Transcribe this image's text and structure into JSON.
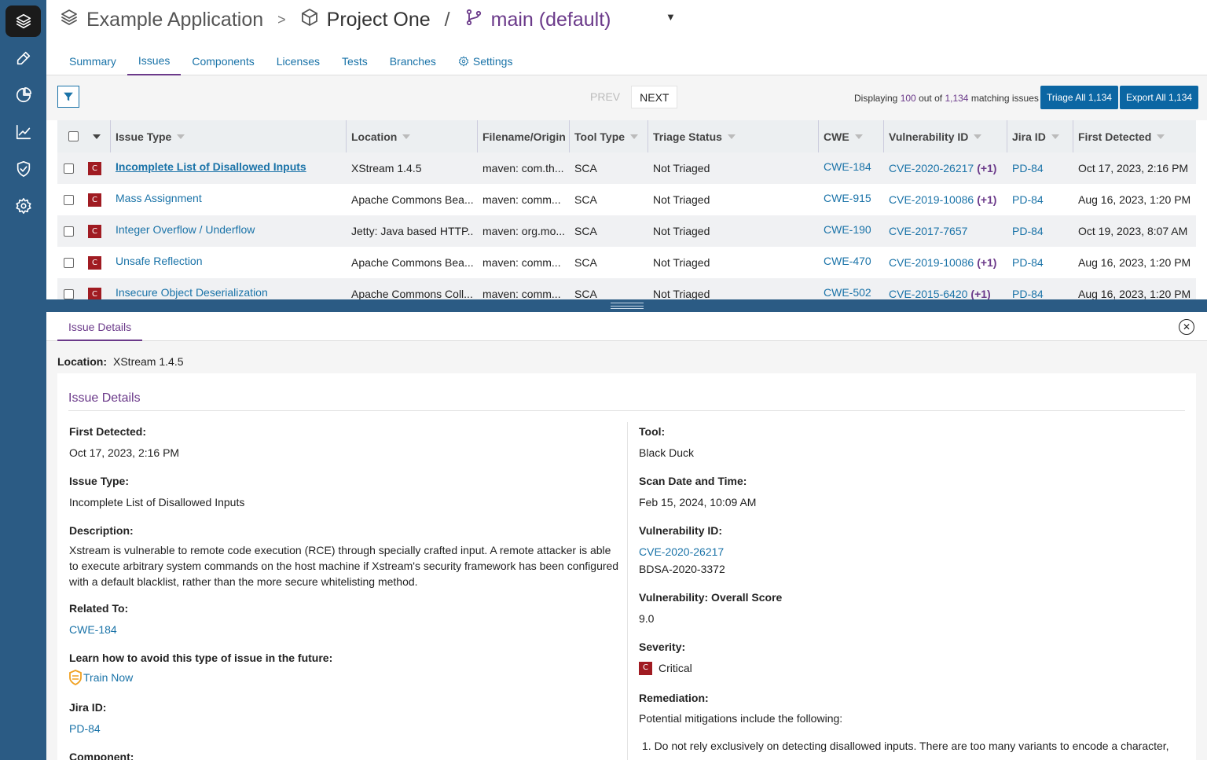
{
  "header": {
    "app_name": "Example Application",
    "separator": ">",
    "project": "Project One",
    "branch_separator": "/",
    "branch": "main (default)",
    "branch_caret": "▼"
  },
  "tabs": [
    "Summary",
    "Issues",
    "Components",
    "Licenses",
    "Tests",
    "Branches",
    "Settings"
  ],
  "toolbar": {
    "prev": "PREV",
    "next": "NEXT",
    "display_prefix": "Displaying",
    "display_count": "100",
    "display_mid": "out of",
    "display_total": "1,134",
    "display_suffix": "matching issues",
    "triage_all": "Triage All 1,134",
    "export_all": "Export All 1,134"
  },
  "table": {
    "columns": [
      "Issue Type",
      "Location",
      "Filename/Origin",
      "Tool Type",
      "Triage Status",
      "CWE",
      "Vulnerability ID",
      "Jira ID",
      "First Detected"
    ],
    "rows": [
      {
        "sev": "C",
        "type": "Incomplete List of Disallowed Inputs",
        "location": "XStream 1.4.5",
        "origin": "maven: com.th...",
        "tool": "SCA",
        "triage": "Not Triaged",
        "cwe": "CWE-184",
        "vuln": "CVE-2020-26217",
        "vuln_extra": "(+1)",
        "jira": "PD-84",
        "detected": "Oct 17, 2023, 2:16 PM"
      },
      {
        "sev": "C",
        "type": "Mass Assignment",
        "location": "Apache Commons Bea...",
        "origin": "maven: comm...",
        "tool": "SCA",
        "triage": "Not Triaged",
        "cwe": "CWE-915",
        "vuln": "CVE-2019-10086",
        "vuln_extra": "(+1)",
        "jira": "PD-84",
        "detected": "Aug 16, 2023, 1:20 PM"
      },
      {
        "sev": "C",
        "type": "Integer Overflow / Underflow",
        "location": "Jetty: Java based HTTP...",
        "origin": "maven: org.mo...",
        "tool": "SCA",
        "triage": "Not Triaged",
        "cwe": "CWE-190",
        "vuln": "CVE-2017-7657",
        "vuln_extra": "",
        "jira": "PD-84",
        "detected": "Oct 19, 2023, 8:07 AM"
      },
      {
        "sev": "C",
        "type": "Unsafe Reflection",
        "location": "Apache Commons Bea...",
        "origin": "maven: comm...",
        "tool": "SCA",
        "triage": "Not Triaged",
        "cwe": "CWE-470",
        "vuln": "CVE-2019-10086",
        "vuln_extra": "(+1)",
        "jira": "PD-84",
        "detected": "Aug 16, 2023, 1:20 PM"
      },
      {
        "sev": "C",
        "type": "Insecure Object Deserialization",
        "location": "Apache Commons Coll...",
        "origin": "maven: comm...",
        "tool": "SCA",
        "triage": "Not Triaged",
        "cwe": "CWE-502",
        "vuln": "CVE-2015-6420",
        "vuln_extra": "(+1)",
        "jira": "PD-84",
        "detected": "Aug 16, 2023, 1:20 PM"
      }
    ]
  },
  "details": {
    "tab": "Issue Details",
    "close": "✕",
    "location_label": "Location:",
    "location_value": "XStream 1.4.5",
    "card_title": "Issue Details",
    "left": {
      "first_detected_label": "First Detected:",
      "first_detected": "Oct 17, 2023, 2:16 PM",
      "issue_type_label": "Issue Type:",
      "issue_type": "Incomplete List of Disallowed Inputs",
      "description_label": "Description:",
      "description": "Xstream is vulnerable to remote code execution (RCE) through specially crafted input. A remote attacker is able to execute arbitrary system commands on the host machine if Xstream's security framework has been configured with a default blacklist, rather than the more secure whitelisting method.",
      "related_label": "Related To:",
      "related": "CWE-184",
      "learn_label": "Learn how to avoid this type of issue in the future:",
      "train_now": "Train Now",
      "jira_label": "Jira ID:",
      "jira": "PD-84",
      "component_label": "Component:"
    },
    "right": {
      "tool_label": "Tool:",
      "tool": "Black Duck",
      "scan_label": "Scan Date and Time:",
      "scan": "Feb 15, 2024, 10:09 AM",
      "vuln_label": "Vulnerability ID:",
      "vuln_cve": "CVE-2020-26217",
      "vuln_bdsa": "BDSA-2020-3372",
      "score_label": "Vulnerability: Overall Score",
      "score": "9.0",
      "severity_label": "Severity:",
      "severity_badge": "C",
      "severity": "Critical",
      "remediation_label": "Remediation:",
      "remediation": "Potential mitigations include the following:",
      "remediation_item": "1. Do not rely exclusively on detecting disallowed inputs. There are too many variants to encode a character,"
    }
  },
  "colors": {
    "sidebar": "#2b5b84",
    "accent_purple": "#6b3a8a",
    "link": "#1a73a8",
    "button": "#0b66a3",
    "critical": "#a01b22"
  }
}
